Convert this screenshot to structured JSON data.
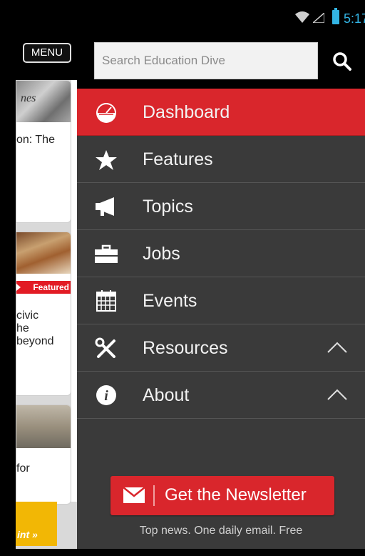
{
  "status_bar": {
    "time": "5:17",
    "wifi_icon": "wifi-icon",
    "signal_icon": "signal-icon",
    "battery_icon": "battery-icon",
    "accent_color": "#33b5e5"
  },
  "background_page": {
    "menu_button_label": "MENU",
    "cards": [
      {
        "image_text": "nes",
        "text_lines": [
          "on: The"
        ]
      },
      {
        "badge": "Featured",
        "text_lines": [
          "civic",
          "he",
          "beyond"
        ]
      },
      {
        "text_lines": [
          "for"
        ]
      }
    ],
    "ad_text": "int »"
  },
  "drawer": {
    "search": {
      "placeholder": "Search Education Dive",
      "value": "",
      "icon": "search-icon"
    },
    "nav_items": [
      {
        "label": "Dashboard",
        "icon": "dashboard-gauge-icon",
        "active": true
      },
      {
        "label": "Features",
        "icon": "star-icon",
        "active": false
      },
      {
        "label": "Topics",
        "icon": "megaphone-icon",
        "active": false
      },
      {
        "label": "Jobs",
        "icon": "briefcase-icon",
        "active": false
      },
      {
        "label": "Events",
        "icon": "calendar-icon",
        "active": false
      },
      {
        "label": "Resources",
        "icon": "tools-icon",
        "expandable": true,
        "chevron": "chevron-up-icon"
      },
      {
        "label": "About",
        "icon": "info-icon",
        "expandable": true,
        "chevron": "chevron-up-icon"
      }
    ],
    "newsletter": {
      "label": "Get the Newsletter",
      "icon": "mail-icon",
      "tagline": "Top news. One daily email. Free"
    },
    "colors": {
      "drawer_bg": "#3a3a3a",
      "active_bg": "#d9262c",
      "newsletter_bg": "#d9262c"
    }
  }
}
